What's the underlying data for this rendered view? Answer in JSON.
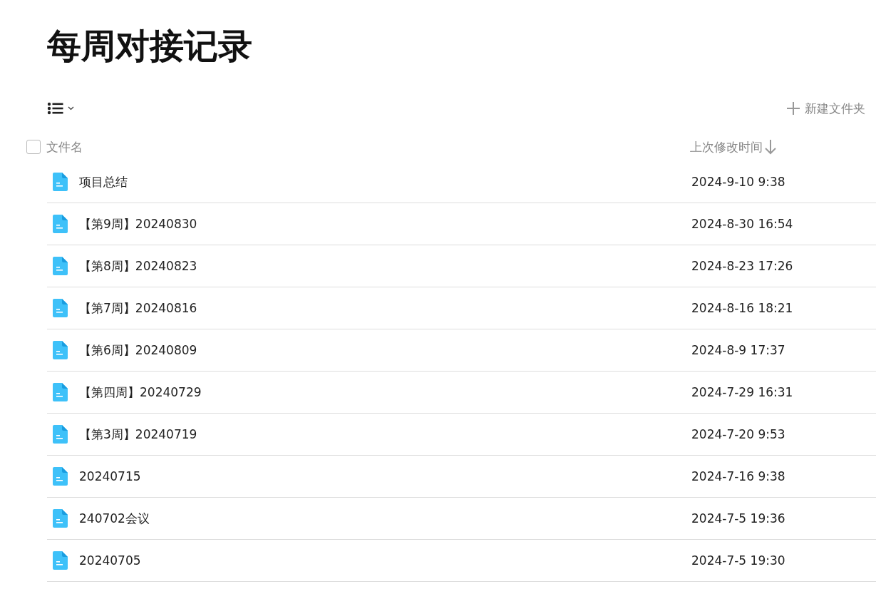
{
  "title": "每周对接记录",
  "toolbar": {
    "new_folder": "新建文件夹"
  },
  "table": {
    "select_all": {
      "checked": false
    },
    "columns": [
      "文件名",
      "上次修改时间"
    ],
    "rows": [
      {
        "name": "项目总结",
        "modified": "2024-9-10 9:38"
      },
      {
        "name": "【第9周】20240830",
        "modified": "2024-8-30 16:54"
      },
      {
        "name": "【第8周】20240823",
        "modified": "2024-8-23 17:26"
      },
      {
        "name": "【第7周】20240816",
        "modified": "2024-8-16 18:21"
      },
      {
        "name": "【第6周】20240809",
        "modified": "2024-8-9 17:37"
      },
      {
        "name": "【第四周】20240729",
        "modified": "2024-7-29 16:31"
      },
      {
        "name": "【第3周】20240719",
        "modified": "2024-7-20 9:53"
      },
      {
        "name": "20240715",
        "modified": "2024-7-16 9:38"
      },
      {
        "name": "240702会议",
        "modified": "2024-7-5 19:36"
      },
      {
        "name": "20240705",
        "modified": "2024-7-5 19:30"
      }
    ]
  }
}
